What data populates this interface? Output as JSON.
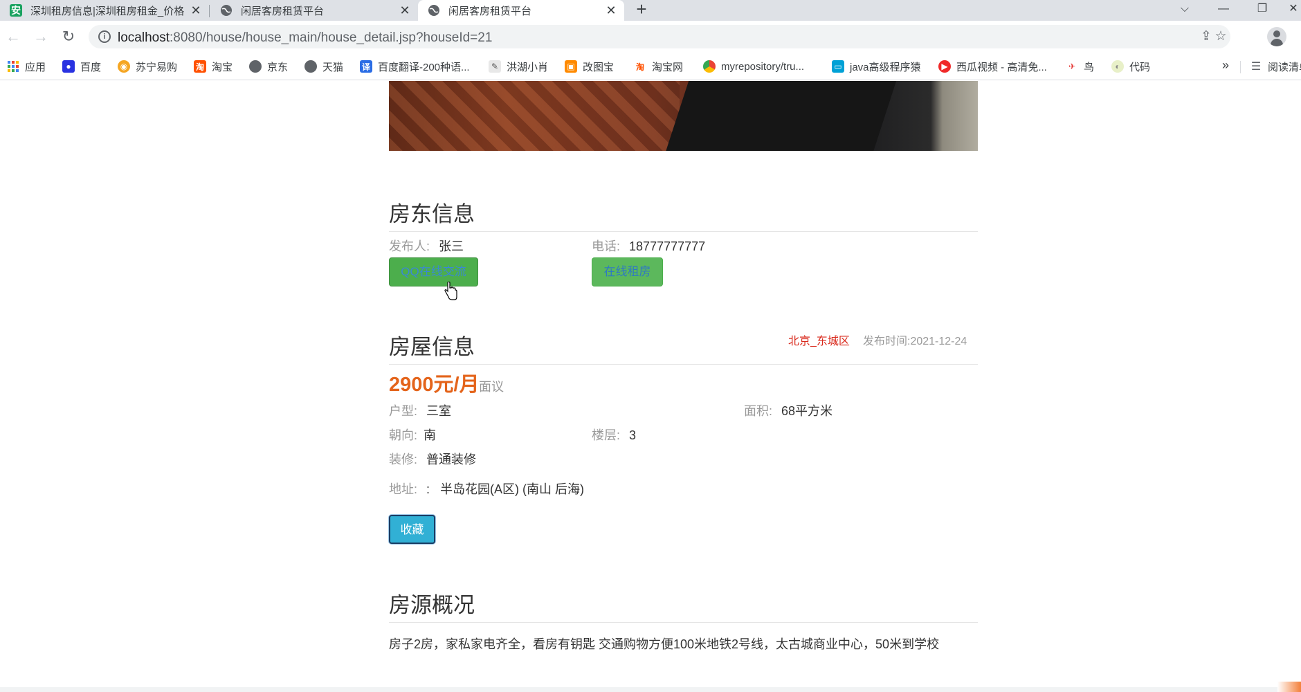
{
  "browser": {
    "tabs": [
      {
        "title": "深圳租房信息|深圳租房租金_价格",
        "favicon": "安"
      },
      {
        "title": "闲居客房租赁平台"
      },
      {
        "title": "闲居客房租赁平台"
      }
    ],
    "url_host": "localhost",
    "url_rest": ":8080/house/house_main/house_detail.jsp?houseId=21",
    "bookmarks": [
      "应用",
      "百度",
      "苏宁易购",
      "淘宝",
      "京东",
      "天猫",
      "百度翻译-200种语...",
      "洪湖小肖",
      "改图宝",
      "淘宝网",
      "myrepository/tru...",
      "java高级程序猿",
      "西瓜视频 - 高清免...",
      "鸟",
      "代码"
    ],
    "reading_list": "阅读清单"
  },
  "landlord": {
    "section_title": "房东信息",
    "publisher_label": "发布人:",
    "publisher": "张三",
    "phone_label": "电话:",
    "phone": "18777777777",
    "qq_button": "QQ在线交流",
    "rent_button": "在线租房"
  },
  "house": {
    "section_title": "房屋信息",
    "location": "北京_东城区",
    "publish_label": "发布时间:",
    "publish_date": "2021-12-24",
    "price": "2900元/月",
    "negotiable": "面议",
    "layout_label": "户型:",
    "layout": "三室",
    "area_label": "面积:",
    "area": "68平方米",
    "orientation_label": "朝向:",
    "orientation": "南",
    "floor_label": "楼层:",
    "floor": "3",
    "decoration_label": "装修:",
    "decoration": "普通装修",
    "address_label": "地址:",
    "address_sep": ":",
    "address": "半岛花园(A区) (南山 后海)",
    "favorite_button": "收藏"
  },
  "overview": {
    "section_title": "房源概况",
    "description": "房子2房，家私家电齐全，看房有钥匙 交通购物方便100米地铁2号线，太古城商业中心，50米到学校"
  },
  "colors": {
    "price": "#e4641b",
    "location": "#d9281b",
    "btn_success": "#5cb85c",
    "btn_info": "#31b0d5"
  }
}
